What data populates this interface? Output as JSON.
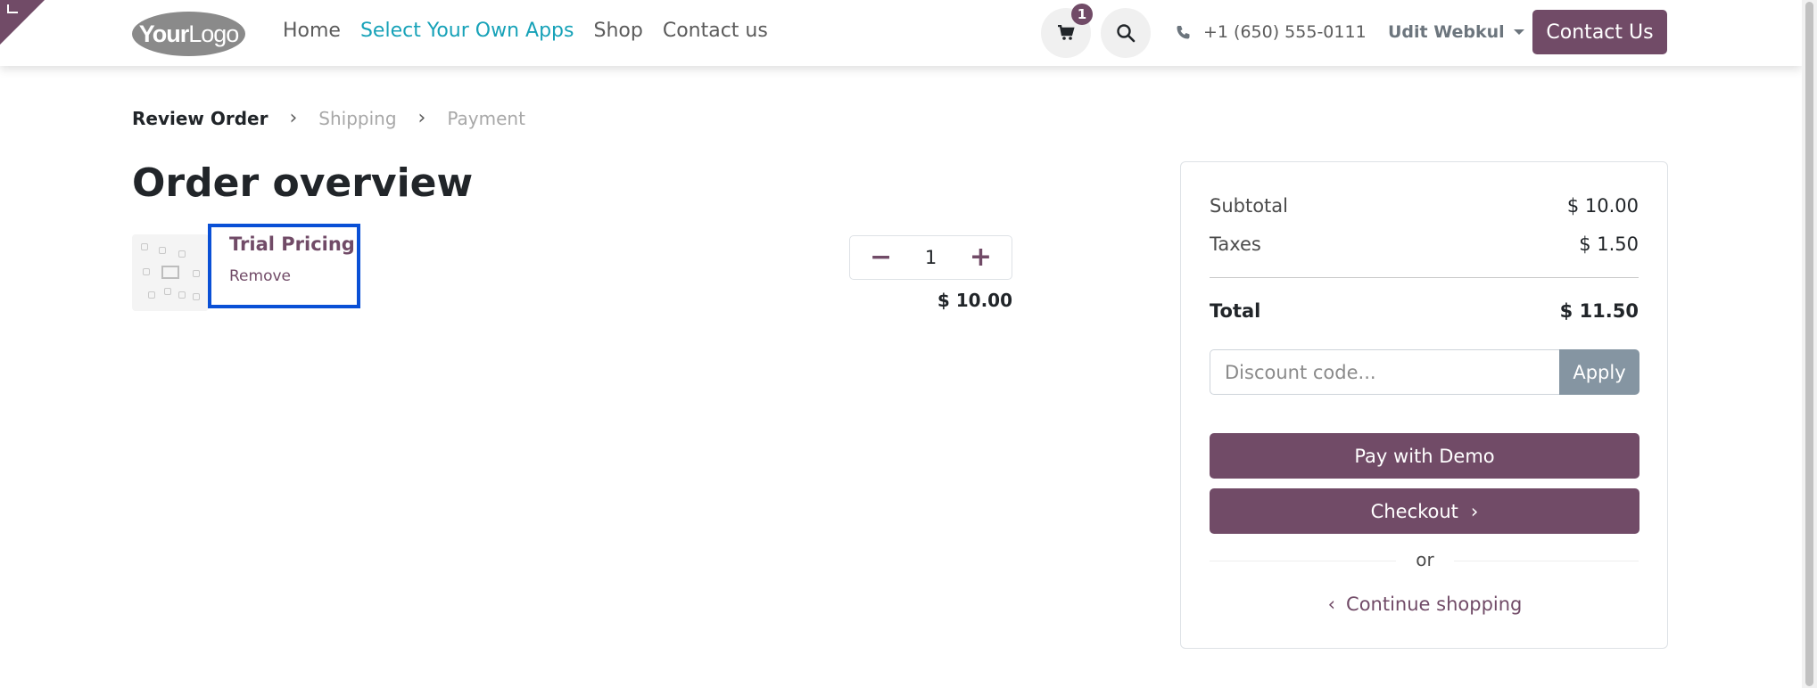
{
  "header": {
    "logo_bold": "Your",
    "logo_light": "Logo",
    "nav": [
      "Home",
      "Select Your Own Apps",
      "Shop",
      "Contact us"
    ],
    "cart_count": "1",
    "phone": "+1 (650) 555-0111",
    "user_name": "Udit Webkul",
    "contact_button": "Contact Us"
  },
  "breadcrumb": {
    "step1": "Review Order",
    "step2": "Shipping",
    "step3": "Payment"
  },
  "page_title": "Order overview",
  "cart_line": {
    "product_name": "Trial Pricing",
    "remove_label": "Remove",
    "quantity": "1",
    "price": "$ 10.00"
  },
  "summary": {
    "subtotal_label": "Subtotal",
    "subtotal_value": "$ 10.00",
    "taxes_label": "Taxes",
    "taxes_value": "$ 1.50",
    "total_label": "Total",
    "total_value": "$ 11.50",
    "discount_placeholder": "Discount code...",
    "apply_label": "Apply",
    "pay_label": "Pay with Demo",
    "checkout_label": "Checkout",
    "or_label": "or",
    "continue_label": "Continue shopping"
  },
  "colors": {
    "brand": "#714b67",
    "accent": "#17a2b8",
    "highlight_border": "#0a50d6",
    "apply_button": "#8595a2"
  },
  "icons": {
    "cart": "cart-icon",
    "search": "search-icon",
    "phone": "phone-icon"
  }
}
